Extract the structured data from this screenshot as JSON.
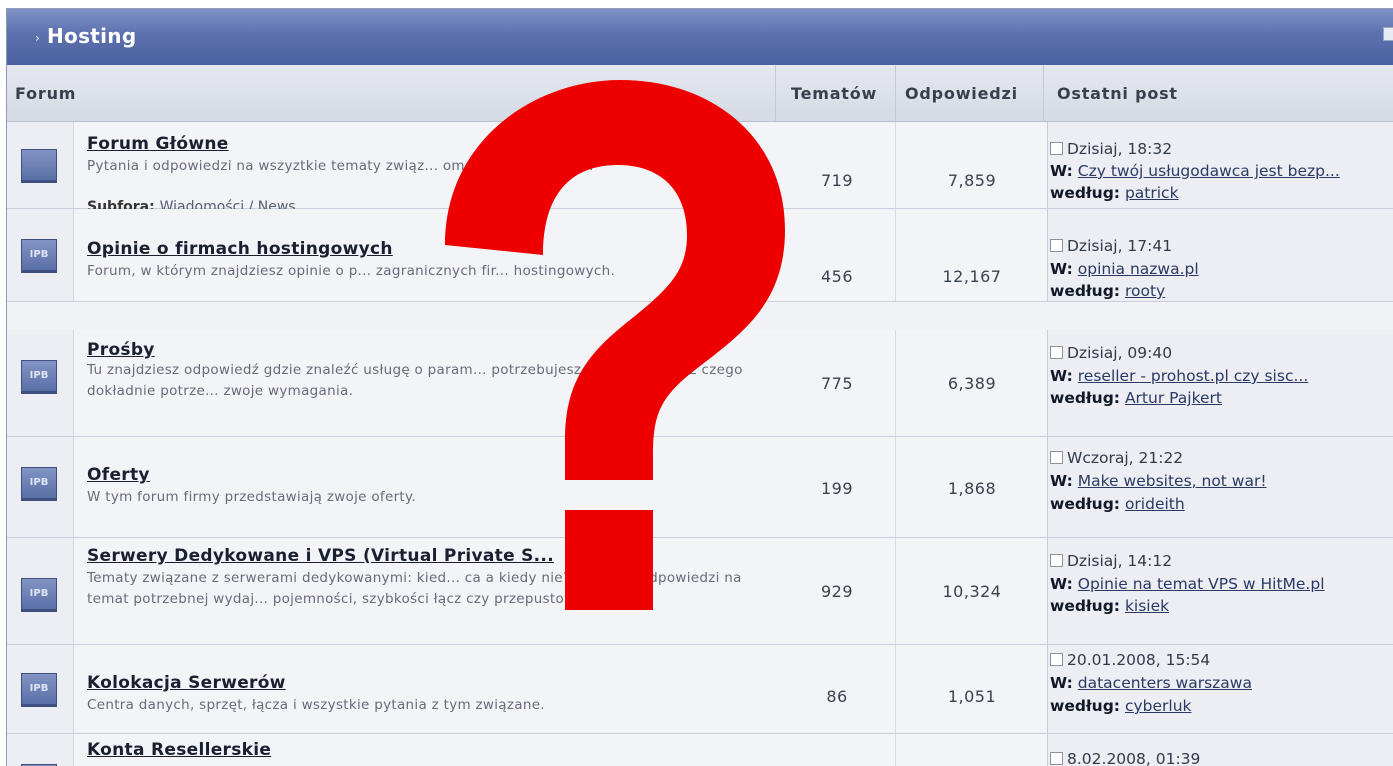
{
  "category": {
    "title": "Hosting"
  },
  "columns": {
    "forum": "Forum",
    "topics": "Tematów",
    "replies": "Odpowiedzi",
    "last_post": "Ostatni post"
  },
  "rows": [
    {
      "name": "Forum Główne",
      "desc": "Pytania i odpowiedzi na wszyztkie tematy związ... om i serwerami www.",
      "subfora_label": "Subfora:",
      "subfora_link": "Wiadomości / News",
      "topics": "719",
      "replies": "7,859",
      "date": "Dzisiaj, 18:32",
      "w_label": "W:",
      "w_topic": "Czy twój usługodawca jest bezp...",
      "by_label": "według:",
      "by_user": "patrick"
    },
    {
      "name": "Opinie o firmach hostingowych",
      "desc": "Forum, w którym znajdziesz opinie o p... zagranicznych fir... hostingowych.",
      "topics": "456",
      "replies": "12,167",
      "date": "Dzisiaj, 17:41",
      "w_label": "W:",
      "w_topic": "opinia nazwa.pl",
      "by_label": "według:",
      "by_user": "rooty"
    },
    {
      "name": "Prośby",
      "desc": "Tu znajdziesz odpowiedź gdzie znaleźć usługę o param... potrzebujesz. Jeżeli nie wiesz czego dokładnie potrze... zwoje wymagania.",
      "topics": "775",
      "replies": "6,389",
      "date": "Dzisiaj, 09:40",
      "w_label": "W:",
      "w_topic": "reseller - prohost.pl czy sisc...",
      "by_label": "według:",
      "by_user": "Artur Pajkert"
    },
    {
      "name": "Oferty",
      "desc": "W tym forum firmy przedstawiają zwoje oferty.",
      "topics": "199",
      "replies": "1,868",
      "date": "Wczoraj, 21:22",
      "w_label": "W:",
      "w_topic": "Make websites, not war!",
      "by_label": "według:",
      "by_user": "orideith"
    },
    {
      "name": "Serwery Dedykowane i VPS (Virtual Private S...",
      "desc": "Tematy związane z serwerami dedykowanymi: kied... ca a kiedy nie? Pytania i odpowiedzi na temat potrzebnej wydaj... pojemności, szybkości łącz czy przepustowości.",
      "topics": "929",
      "replies": "10,324",
      "date": "Dzisiaj, 14:12",
      "w_label": "W:",
      "w_topic": "Opinie na temat VPS w HitMe.pl",
      "by_label": "według:",
      "by_user": "kisiek"
    },
    {
      "name": "Kolokacja Serwerów",
      "desc": "Centra danych, sprzęt, łącza i wszystkie pytania z tym związane.",
      "topics": "86",
      "replies": "1,051",
      "date": "20.01.2008, 15:54",
      "w_label": "W:",
      "w_topic": "datacenters warszawa",
      "by_label": "według:",
      "by_user": "cyberluk"
    },
    {
      "name": "Konta Resellerskie",
      "date": "8.02.2008, 01:39"
    }
  ],
  "icons": {
    "forum": "forum-folder-icon",
    "post": "post-icon",
    "overlay": "question-mark-icon"
  },
  "colors": {
    "overlay": "#ee0000",
    "header": "#5c71ad"
  }
}
